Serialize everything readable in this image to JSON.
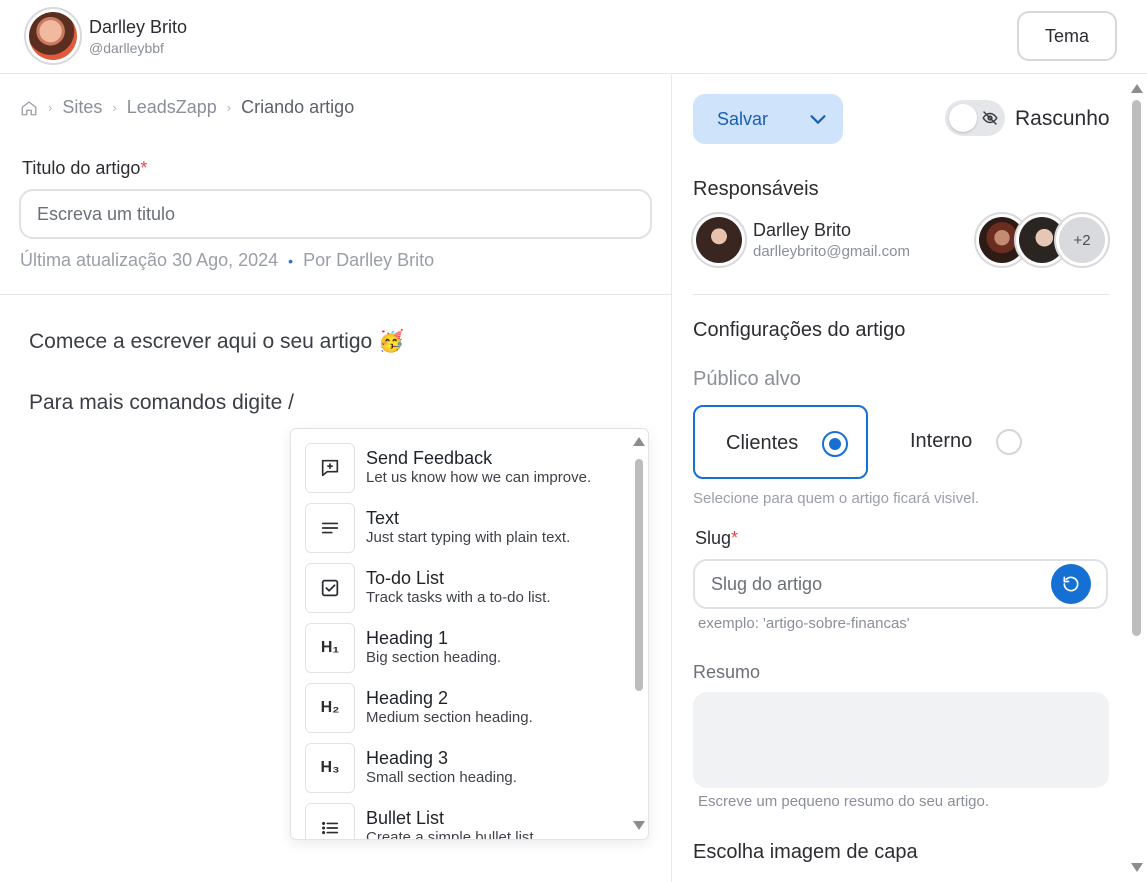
{
  "header": {
    "user_name": "Darlley Brito",
    "user_handle": "@darlleybbf",
    "theme_label": "Tema"
  },
  "breadcrumb": {
    "items": [
      "Sites",
      "LeadsZapp",
      "Criando artigo"
    ]
  },
  "article": {
    "title_label": "Titulo do artigo",
    "required_mark": "*",
    "title_placeholder": "Escreva um titulo",
    "last_update": "Última atualização 30 Ago, 2024",
    "meta_dot": "•",
    "author": "Por Darlley Brito",
    "editor_line1": "Comece a escrever aqui o seu artigo 🥳",
    "editor_line2": "Para mais comandos digite /"
  },
  "command_menu": {
    "items": [
      {
        "icon": "message-plus-icon",
        "title": "Send Feedback",
        "desc": "Let us know how we can improve."
      },
      {
        "icon": "text-icon",
        "title": "Text",
        "desc": "Just start typing with plain text."
      },
      {
        "icon": "checkbox-icon",
        "title": "To-do List",
        "desc": "Track tasks with a to-do list."
      },
      {
        "icon": "heading1-icon",
        "glyph": "H₁",
        "title": "Heading 1",
        "desc": "Big section heading."
      },
      {
        "icon": "heading2-icon",
        "glyph": "H₂",
        "title": "Heading 2",
        "desc": "Medium section heading."
      },
      {
        "icon": "heading3-icon",
        "glyph": "H₃",
        "title": "Heading 3",
        "desc": "Small section heading."
      },
      {
        "icon": "bullet-list-icon",
        "title": "Bullet List",
        "desc": "Create a simple bullet list."
      }
    ]
  },
  "sidebar": {
    "save_label": "Salvar",
    "draft_label": "Rascunho",
    "draft_enabled": false,
    "responsibles_label": "Responsáveis",
    "responsible": {
      "name": "Darlley Brito",
      "email": "darlleybrito@gmail.com"
    },
    "extra_count": "+2",
    "config_label": "Configurações do artigo",
    "audience_label": "Público alvo",
    "audience_options": [
      "Clientes",
      "Interno"
    ],
    "audience_selected": "Clientes",
    "audience_help": "Selecione para quem o artigo ficará visivel.",
    "slug_label": "Slug",
    "required_mark": "*",
    "slug_placeholder": "Slug do artigo",
    "slug_example": "exemplo: 'artigo-sobre-financas'",
    "summary_label": "Resumo",
    "summary_help": "Escreve um pequeno resumo do seu artigo.",
    "cover_label": "Escolha imagem de capa"
  },
  "colors": {
    "accent": "#1670d4",
    "save_bg": "#cfe3fb",
    "required": "#e5484d"
  }
}
